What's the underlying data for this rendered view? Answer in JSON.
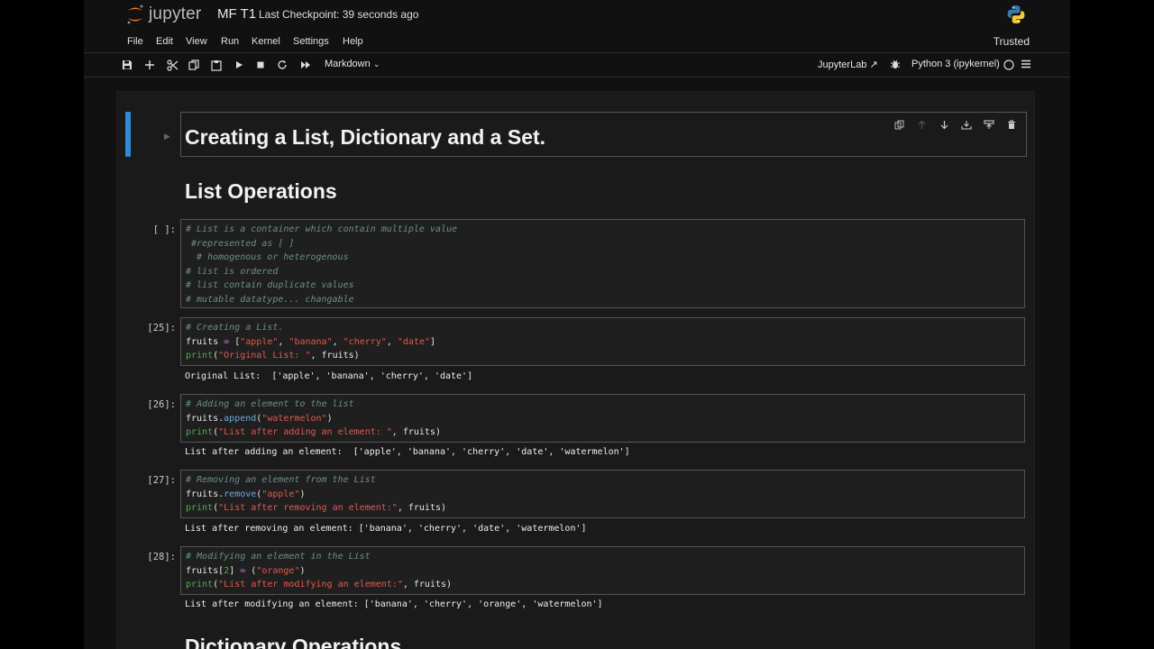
{
  "header": {
    "logo_text": "jupyter",
    "notebook_name": "MF T1",
    "checkpoint": "Last Checkpoint: 39 seconds ago"
  },
  "menu": [
    "File",
    "Edit",
    "View",
    "Run",
    "Kernel",
    "Settings",
    "Help"
  ],
  "trusted": "Trusted",
  "toolbar": {
    "cell_type": "Markdown",
    "jupyterlab": "JupyterLab",
    "kernel": "Python 3 (ipykernel)"
  },
  "cells": {
    "title": "Creating a List, Dictionary and a Set.",
    "list_ops": "List Operations",
    "c0": {
      "prompt": "[ ]:",
      "lines": [
        "# List is a container which contain multiple value",
        " #represented as [ ]",
        "  # homogenous or heterogenous",
        "# list is ordered",
        "# list contain duplicate values",
        "# mutable datatype... changable"
      ]
    },
    "c1": {
      "prompt": "[25]:",
      "l1": "# Creating a List.",
      "l2a": "fruits ",
      "l2b": "= ",
      "l2c": "[",
      "l2d": "\"apple\"",
      "l2e": ", ",
      "l2f": "\"banana\"",
      "l2g": ", ",
      "l2h": "\"cherry\"",
      "l2i": ", ",
      "l2j": "\"date\"",
      "l2k": "]",
      "l3a": "print",
      "l3b": "(",
      "l3c": "\"Original List: \"",
      "l3d": ", fruits)",
      "output": "Original List:  ['apple', 'banana', 'cherry', 'date']"
    },
    "c2": {
      "prompt": "[26]:",
      "l1": "# Adding an element to the list",
      "l2a": "fruits.",
      "l2b": "append",
      "l2c": "(",
      "l2d": "\"watermelon\"",
      "l2e": ")",
      "l3a": "print",
      "l3b": "(",
      "l3c": "\"List after adding an element: \"",
      "l3d": ", fruits)",
      "output": "List after adding an element:  ['apple', 'banana', 'cherry', 'date', 'watermelon']"
    },
    "c3": {
      "prompt": "[27]:",
      "l1": "# Removing an element from the List",
      "l2a": "fruits.",
      "l2b": "remove",
      "l2c": "(",
      "l2d": "\"apple\"",
      "l2e": ")",
      "l3a": "print",
      "l3b": "(",
      "l3c": "\"List after removing an element:\"",
      "l3d": ", fruits)",
      "output": "List after removing an element: ['banana', 'cherry', 'date', 'watermelon']"
    },
    "c4": {
      "prompt": "[28]:",
      "l1": "# Modifying an element in the List",
      "l2a": "fruits[",
      "l2b": "2",
      "l2c": "] ",
      "l2d": "= ",
      "l2e": "(",
      "l2f": "\"orange\"",
      "l2g": ")",
      "l3a": "print",
      "l3b": "(",
      "l3c": "\"List after modifying an element:\"",
      "l3d": ", fruits)",
      "output": "List after modifying an element: ['banana', 'cherry', 'orange', 'watermelon']"
    },
    "dict_ops": "Dictionary Operations"
  }
}
